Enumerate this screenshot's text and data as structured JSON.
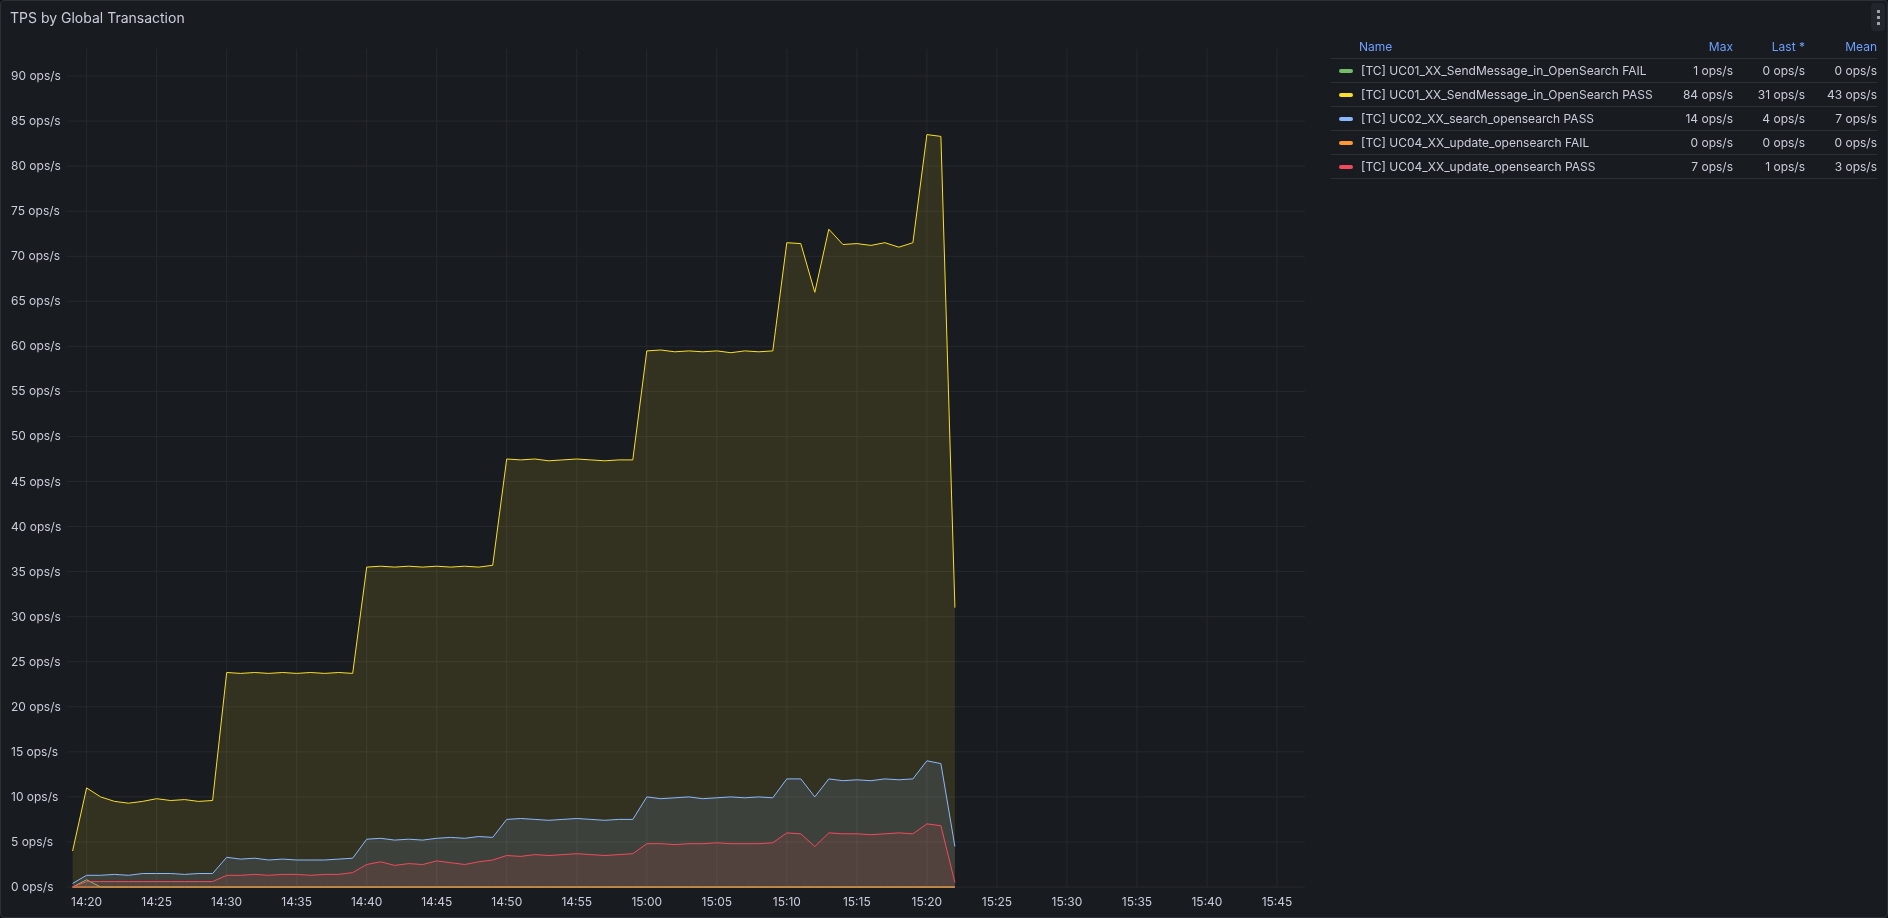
{
  "panel": {
    "title": "TPS by Global Transaction"
  },
  "chart_data": {
    "type": "area",
    "categories": [
      null,
      "14:20",
      null,
      null,
      null,
      null,
      "14:25",
      null,
      null,
      null,
      null,
      "14:30",
      null,
      null,
      null,
      null,
      "14:35",
      null,
      null,
      null,
      null,
      "14:40",
      null,
      null,
      null,
      null,
      "14:45",
      null,
      null,
      null,
      null,
      "14:50",
      null,
      null,
      null,
      null,
      "14:55",
      null,
      null,
      null,
      null,
      "15:00",
      null,
      null,
      null,
      null,
      "15:05",
      null,
      null,
      null,
      null,
      "15:10",
      null,
      null,
      null,
      null,
      "15:15",
      null,
      null,
      null,
      null,
      "15:20",
      null,
      null,
      null,
      null,
      "15:25",
      null,
      null,
      null,
      null,
      "15:30",
      null,
      null,
      null,
      null,
      "15:35",
      null,
      null,
      null,
      null,
      "15:40",
      null,
      null,
      null,
      null,
      "15:45",
      null,
      null
    ],
    "series": [
      {
        "name": "[TC] UC01_XX_SendMessage_in_OpenSearch FAIL",
        "color": "#73bf69",
        "values": [
          0,
          0.8,
          0,
          0,
          0,
          0,
          0,
          0,
          0,
          0,
          0,
          0,
          0,
          0,
          0,
          0,
          0,
          0,
          0,
          0,
          0,
          0,
          0,
          0,
          0,
          0,
          0,
          0,
          0,
          0,
          0,
          0,
          0,
          0,
          0,
          0,
          0,
          0,
          0,
          0,
          0,
          0,
          0,
          0,
          0,
          0,
          0,
          0,
          0,
          0,
          0,
          0,
          0,
          0,
          0,
          0,
          0,
          0,
          0,
          0,
          0,
          0,
          0,
          0,
          null,
          null,
          null,
          null,
          null,
          null,
          null,
          null,
          null,
          null,
          null,
          null,
          null,
          null,
          null,
          null,
          null,
          null,
          null,
          null,
          null,
          null,
          null,
          null,
          null
        ]
      },
      {
        "name": "[TC] UC01_XX_SendMessage_in_OpenSearch PASS",
        "color": "#fade2a",
        "values": [
          4,
          11,
          10,
          9.5,
          9.3,
          9.5,
          9.8,
          9.6,
          9.7,
          9.5,
          9.6,
          23.8,
          23.7,
          23.8,
          23.7,
          23.8,
          23.7,
          23.8,
          23.7,
          23.8,
          23.7,
          35.5,
          35.6,
          35.5,
          35.6,
          35.5,
          35.6,
          35.5,
          35.6,
          35.5,
          35.7,
          47.5,
          47.4,
          47.5,
          47.3,
          47.4,
          47.5,
          47.4,
          47.3,
          47.4,
          47.4,
          59.5,
          59.6,
          59.4,
          59.5,
          59.4,
          59.5,
          59.3,
          59.5,
          59.4,
          59.5,
          71.5,
          71.4,
          66,
          73,
          71.3,
          71.4,
          71.2,
          71.5,
          71,
          71.5,
          83.5,
          83.3,
          31,
          null,
          null,
          null,
          null,
          null,
          null,
          null,
          null,
          null,
          null,
          null,
          null,
          null,
          null,
          null,
          null,
          null,
          null,
          null,
          null,
          null,
          null,
          null,
          null,
          null
        ]
      },
      {
        "name": "[TC] UC02_XX_search_opensearch PASS",
        "color": "#8ab8ff",
        "values": [
          0.4,
          1.3,
          1.3,
          1.4,
          1.3,
          1.5,
          1.5,
          1.5,
          1.4,
          1.5,
          1.5,
          3.3,
          3.1,
          3.2,
          3,
          3.1,
          3,
          3,
          3,
          3.1,
          3.2,
          5.3,
          5.4,
          5.2,
          5.3,
          5.2,
          5.4,
          5.5,
          5.4,
          5.6,
          5.5,
          7.5,
          7.6,
          7.5,
          7.4,
          7.5,
          7.6,
          7.5,
          7.4,
          7.5,
          7.5,
          10,
          9.8,
          9.9,
          10,
          9.8,
          9.9,
          10,
          9.9,
          10,
          9.9,
          12,
          12,
          10,
          12,
          11.8,
          11.9,
          11.8,
          12,
          11.9,
          12,
          14,
          13.7,
          4.5,
          null,
          null,
          null,
          null,
          null,
          null,
          null,
          null,
          null,
          null,
          null,
          null,
          null,
          null,
          null,
          null,
          null,
          null,
          null,
          null,
          null,
          null,
          null,
          null,
          null
        ]
      },
      {
        "name": "[TC] UC04_XX_update_opensearch FAIL",
        "color": "#ff9830",
        "values": [
          0,
          0,
          0,
          0,
          0,
          0,
          0,
          0,
          0,
          0,
          0,
          0,
          0,
          0,
          0,
          0,
          0,
          0,
          0,
          0,
          0,
          0,
          0,
          0,
          0,
          0,
          0,
          0,
          0,
          0,
          0,
          0,
          0,
          0,
          0,
          0,
          0,
          0,
          0,
          0,
          0,
          0,
          0,
          0,
          0,
          0,
          0,
          0,
          0,
          0,
          0,
          0,
          0,
          0,
          0,
          0,
          0,
          0,
          0,
          0,
          0,
          0,
          0,
          0,
          null,
          null,
          null,
          null,
          null,
          null,
          null,
          null,
          null,
          null,
          null,
          null,
          null,
          null,
          null,
          null,
          null,
          null,
          null,
          null,
          null,
          null,
          null,
          null,
          null
        ]
      },
      {
        "name": "[TC] UC04_XX_update_opensearch PASS",
        "color": "#f2495c",
        "values": [
          0,
          0.6,
          0.6,
          0.6,
          0.6,
          0.6,
          0.6,
          0.6,
          0.6,
          0.6,
          0.6,
          1.3,
          1.3,
          1.4,
          1.3,
          1.4,
          1.4,
          1.3,
          1.4,
          1.4,
          1.6,
          2.5,
          2.8,
          2.4,
          2.6,
          2.5,
          2.9,
          2.7,
          2.5,
          2.8,
          3,
          3.5,
          3.4,
          3.6,
          3.5,
          3.6,
          3.7,
          3.6,
          3.5,
          3.6,
          3.7,
          4.8,
          4.8,
          4.7,
          4.8,
          4.8,
          4.9,
          4.8,
          4.8,
          4.8,
          4.9,
          6,
          5.9,
          4.5,
          6,
          5.9,
          5.9,
          5.8,
          5.9,
          6,
          5.9,
          7,
          6.8,
          0.5,
          null,
          null,
          null,
          null,
          null,
          null,
          null,
          null,
          null,
          null,
          null,
          null,
          null,
          null,
          null,
          null,
          null,
          null,
          null,
          null,
          null,
          null,
          null,
          null,
          null
        ]
      }
    ],
    "grid": true,
    "ylim": [
      0,
      93
    ],
    "yticks": [
      {
        "value": 0,
        "label": "0 ops/s"
      },
      {
        "value": 5,
        "label": "5 ops/s"
      },
      {
        "value": 10,
        "label": "10 ops/s"
      },
      {
        "value": 15,
        "label": "15 ops/s"
      },
      {
        "value": 20,
        "label": "20 ops/s"
      },
      {
        "value": 25,
        "label": "25 ops/s"
      },
      {
        "value": 30,
        "label": "30 ops/s"
      },
      {
        "value": 35,
        "label": "35 ops/s"
      },
      {
        "value": 40,
        "label": "40 ops/s"
      },
      {
        "value": 45,
        "label": "45 ops/s"
      },
      {
        "value": 50,
        "label": "50 ops/s"
      },
      {
        "value": 55,
        "label": "55 ops/s"
      },
      {
        "value": 60,
        "label": "60 ops/s"
      },
      {
        "value": 65,
        "label": "65 ops/s"
      },
      {
        "value": 70,
        "label": "70 ops/s"
      },
      {
        "value": 75,
        "label": "75 ops/s"
      },
      {
        "value": 80,
        "label": "80 ops/s"
      },
      {
        "value": 85,
        "label": "85 ops/s"
      },
      {
        "value": 90,
        "label": "90 ops/s"
      }
    ]
  },
  "legend": {
    "columns": [
      "Name",
      "Max",
      "Last *",
      "Mean"
    ],
    "rows": [
      {
        "max": "1 ops/s",
        "last": "0 ops/s",
        "mean": "0 ops/s"
      },
      {
        "max": "84 ops/s",
        "last": "31 ops/s",
        "mean": "43 ops/s"
      },
      {
        "max": "14 ops/s",
        "last": "4 ops/s",
        "mean": "7 ops/s"
      },
      {
        "max": "0 ops/s",
        "last": "0 ops/s",
        "mean": "0 ops/s"
      },
      {
        "max": "7 ops/s",
        "last": "1 ops/s",
        "mean": "3 ops/s"
      }
    ]
  }
}
